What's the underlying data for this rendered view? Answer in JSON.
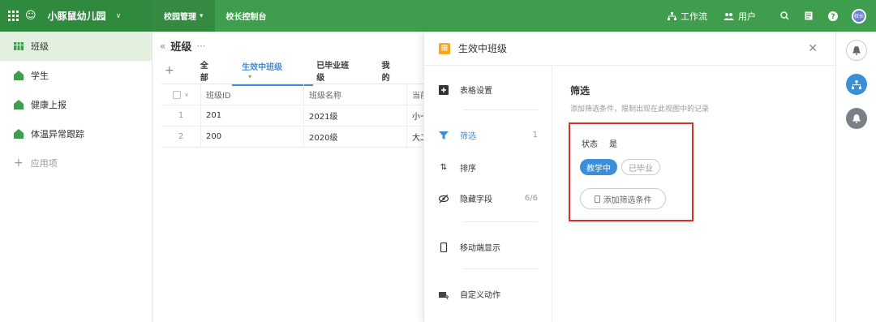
{
  "topbar": {
    "app_name": "小豚鼠幼儿园",
    "tabs": [
      {
        "label": "校园管理"
      },
      {
        "label": "校长控制台"
      }
    ],
    "workflow_label": "工作流",
    "users_label": "用户",
    "avatar_text": "校长"
  },
  "sidebar": {
    "items": [
      {
        "label": "班级"
      },
      {
        "label": "学生"
      },
      {
        "label": "健康上报"
      },
      {
        "label": "体温异常跟踪"
      }
    ],
    "add_label": "应用项"
  },
  "main": {
    "title": "班级",
    "views": [
      "全部",
      "生效中班级",
      "已毕业班级",
      "我的"
    ],
    "table": {
      "columns": [
        "班级ID",
        "班级名称",
        "当前"
      ],
      "rows": [
        {
          "index": "1",
          "id": "201",
          "name": "2021级",
          "current": "小一"
        },
        {
          "index": "2",
          "id": "200",
          "name": "2020级",
          "current": "大二"
        }
      ]
    }
  },
  "panel": {
    "title": "生效中班级",
    "menu": [
      {
        "label": "表格设置",
        "count": ""
      },
      {
        "label": "筛选",
        "count": "1"
      },
      {
        "label": "排序",
        "count": ""
      },
      {
        "label": "隐藏字段",
        "count": "6/6"
      },
      {
        "label": "移动端显示",
        "count": ""
      },
      {
        "label": "自定义动作",
        "count": ""
      }
    ],
    "filter": {
      "heading": "筛选",
      "description": "添加筛选条件，限制出现在此视图中的记录",
      "field_label": "状态",
      "operator": "是",
      "options": [
        "教学中",
        "已毕业"
      ],
      "add_button": "添加筛选条件"
    }
  },
  "colors": {
    "topbar": "#3f9e4d",
    "accent": "#3c8ed8",
    "highlight_border": "#d9302c",
    "sidebar_active": "#e3f0e0"
  }
}
